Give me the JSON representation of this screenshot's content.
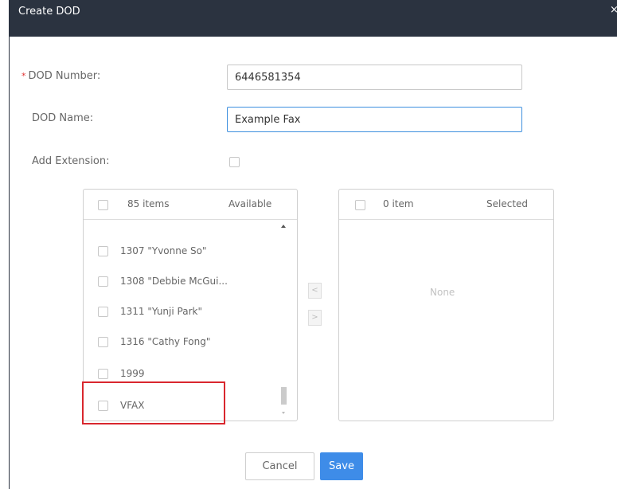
{
  "dialog": {
    "title": "Create DOD",
    "close_glyph": "×"
  },
  "form": {
    "dod_number": {
      "label": "DOD Number:",
      "required_mark": "*",
      "value": "6446581354"
    },
    "dod_name": {
      "label": "DOD Name:",
      "value": "Example Fax"
    },
    "add_extension": {
      "label": "Add Extension:",
      "checked": false
    }
  },
  "available": {
    "count": "85 items",
    "title": "Available",
    "items": [
      "1307 \"Yvonne So\"",
      "1308 \"Debbie McGui...",
      "1311 \"Yunji Park\"",
      "1316 \"Cathy Fong\"",
      "1999",
      "VFAX"
    ],
    "highlighted_item": "VFAX"
  },
  "selected": {
    "count": "0 item",
    "title": "Selected",
    "empty_text": "None"
  },
  "transfer": {
    "move_left": "<",
    "move_right": ">"
  },
  "buttons": {
    "cancel": "Cancel",
    "save": "Save"
  },
  "colors": {
    "titlebar": "#2b3340",
    "primary": "#3e8ce8",
    "highlight": "#d9272e",
    "required": "#e03131"
  }
}
